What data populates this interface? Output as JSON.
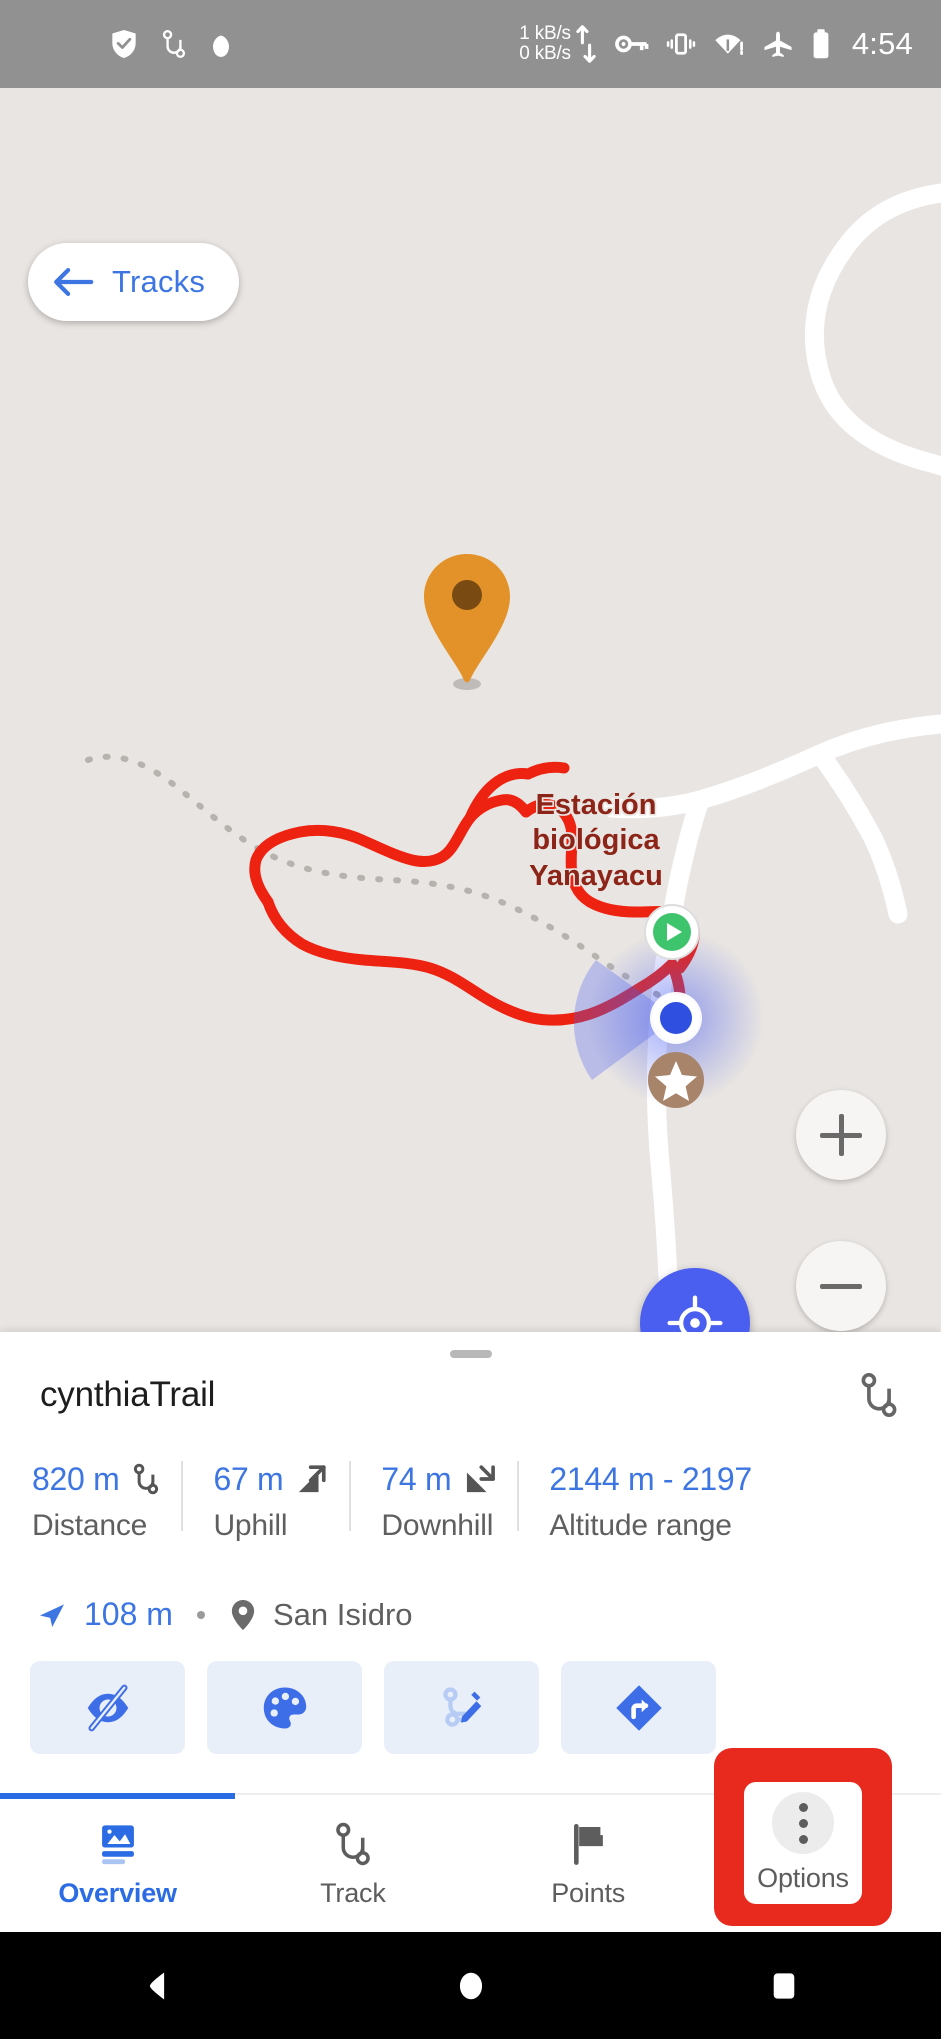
{
  "statusbar": {
    "left_icons": [
      "shield-check-icon",
      "track-route-icon",
      "location-balloon-icon"
    ],
    "net_up": "1 kB/s",
    "net_down": "0 kB/s",
    "right_icons": [
      "vpn-key-icon",
      "vibrate-icon",
      "wifi-no-internet-icon",
      "airplane-mode-icon",
      "battery-icon"
    ],
    "clock": "4:54",
    "bg_color": "#919191"
  },
  "map": {
    "back_button": {
      "label": "Tracks",
      "icon": "arrow-left-icon",
      "color": "#3d76e3"
    },
    "place_label": "Estación\nbiológica\nYanayacu",
    "place_label_line1": "Estación",
    "place_label_line2": "biológica",
    "place_label_line3": "Yanayacu",
    "place_label_color": "#8c2418",
    "markers": {
      "selected_pin": "map-pin-marker",
      "start_marker": "track-start-play-icon",
      "favorite_marker": "star-marker-icon",
      "my_position": "gps-position-dot"
    },
    "track_color": "#ee2211",
    "background_color": "#e9e5e2",
    "controls": {
      "zoom_in": "+",
      "zoom_out": "−",
      "my_location": "my-location-icon"
    }
  },
  "sheet": {
    "title": "cynthiaTrail",
    "title_icon": "track-route-icon",
    "stats": [
      {
        "value": "820 m",
        "label": "Distance",
        "icon": "track-route-icon"
      },
      {
        "value": "67 m",
        "label": "Uphill",
        "icon": "uphill-arrow-icon"
      },
      {
        "value": "74 m",
        "label": "Downhill",
        "icon": "downhill-arrow-icon"
      },
      {
        "value": "2144 m - 2197",
        "label": "Altitude range",
        "icon": ""
      }
    ],
    "location_row": {
      "direction_icon": "navigation-arrow-icon",
      "distance": "108 m",
      "separator": "•",
      "place_icon": "map-pin-icon",
      "place": "San Isidro"
    },
    "actions": [
      {
        "name": "hide-track-button",
        "icon": "eye-slash-icon"
      },
      {
        "name": "appearance-button",
        "icon": "palette-icon"
      },
      {
        "name": "edit-track-button",
        "icon": "edit-track-icon"
      },
      {
        "name": "directions-button",
        "icon": "directions-diamond-icon"
      }
    ],
    "accent_color": "#3d76e3",
    "action_bg_color": "#e9eff9"
  },
  "tabs": [
    {
      "label": "Overview",
      "icon": "overview-image-icon",
      "active": true
    },
    {
      "label": "Track",
      "icon": "track-route-icon",
      "active": false
    },
    {
      "label": "Points",
      "icon": "flag-icon",
      "active": false
    },
    {
      "label": "Options",
      "icon": "more-vertical-icon",
      "active": false
    }
  ],
  "highlight": {
    "target": "Options",
    "color": "#e8291e"
  },
  "navbar": {
    "back": "nav-back-triangle-icon",
    "home": "nav-home-circle-icon",
    "recents": "nav-recents-square-icon",
    "bg_color": "#000000"
  }
}
